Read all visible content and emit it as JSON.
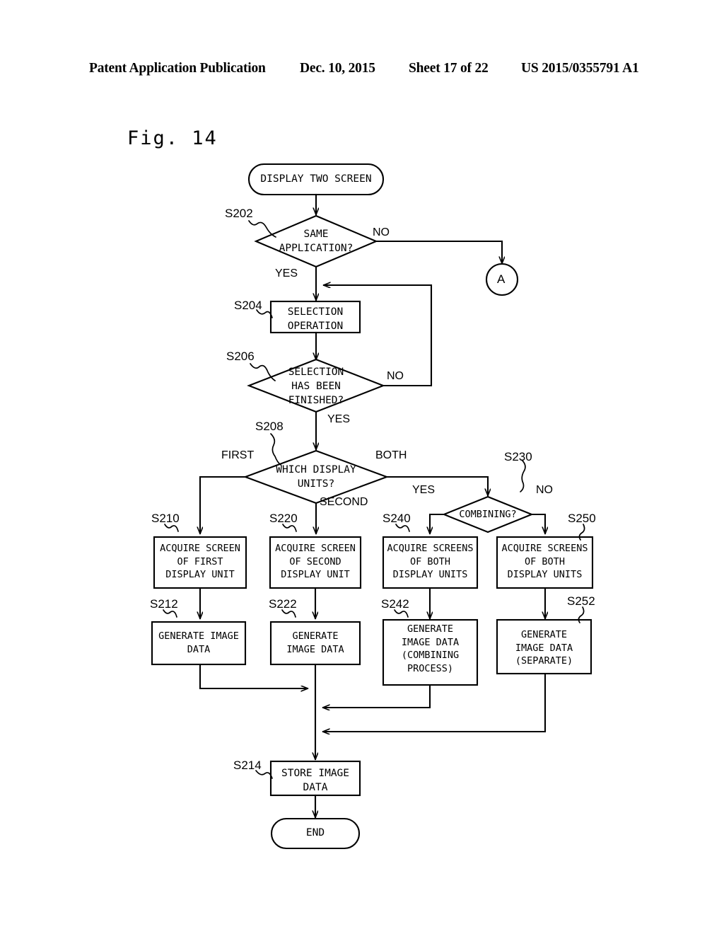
{
  "header": {
    "publication": "Patent Application Publication",
    "date": "Dec. 10, 2015",
    "sheet": "Sheet 17 of 22",
    "number": "US 2015/0355791 A1"
  },
  "figure": {
    "label": "Fig. 14"
  },
  "nodes": {
    "start": {
      "text": "DISPLAY TWO SCREEN",
      "shape": "terminal"
    },
    "s202": {
      "step": "S202",
      "text": "SAME\nAPPLICATION?",
      "shape": "decision"
    },
    "s204": {
      "step": "S204",
      "text": "SELECTION\nOPERATION",
      "shape": "process"
    },
    "s206": {
      "step": "S206",
      "text": "SELECTION\nHAS BEEN\nFINISHED?",
      "shape": "decision"
    },
    "s208": {
      "step": "S208",
      "text": "WHICH DISPLAY\nUNITS?",
      "shape": "decision"
    },
    "s230": {
      "step": "S230",
      "text": "COMBINING?",
      "shape": "decision"
    },
    "s210": {
      "step": "S210",
      "text": "ACQUIRE SCREEN\nOF FIRST\nDISPLAY UNIT",
      "shape": "process"
    },
    "s220": {
      "step": "S220",
      "text": "ACQUIRE SCREEN\nOF SECOND\nDISPLAY UNIT",
      "shape": "process"
    },
    "s240": {
      "step": "S240",
      "text": "ACQUIRE SCREENS\nOF BOTH\nDISPLAY UNITS",
      "shape": "process"
    },
    "s250": {
      "step": "S250",
      "text": "ACQUIRE SCREENS\nOF BOTH\nDISPLAY UNITS",
      "shape": "process"
    },
    "s212": {
      "step": "S212",
      "text": "GENERATE IMAGE\nDATA",
      "shape": "process"
    },
    "s222": {
      "step": "S222",
      "text": "GENERATE\nIMAGE DATA",
      "shape": "process"
    },
    "s242": {
      "step": "S242",
      "text": "GENERATE\nIMAGE DATA\n(COMBINING\nPROCESS)",
      "shape": "process"
    },
    "s252": {
      "step": "S252",
      "text": "GENERATE\nIMAGE DATA\n(SEPARATE)",
      "shape": "process"
    },
    "s214": {
      "step": "S214",
      "text": "STORE IMAGE\nDATA",
      "shape": "process"
    },
    "end": {
      "text": "END",
      "shape": "terminal"
    },
    "connector_a": {
      "text": "A",
      "shape": "connector"
    }
  },
  "edge_labels": {
    "s202_no": "NO",
    "s202_yes": "YES",
    "s206_no": "NO",
    "s206_yes": "YES",
    "s208_first": "FIRST",
    "s208_second": "SECOND",
    "s208_both": "BOTH",
    "s230_yes": "YES",
    "s230_no": "NO"
  },
  "style": {
    "line_color": "#000000",
    "background": "#ffffff"
  }
}
